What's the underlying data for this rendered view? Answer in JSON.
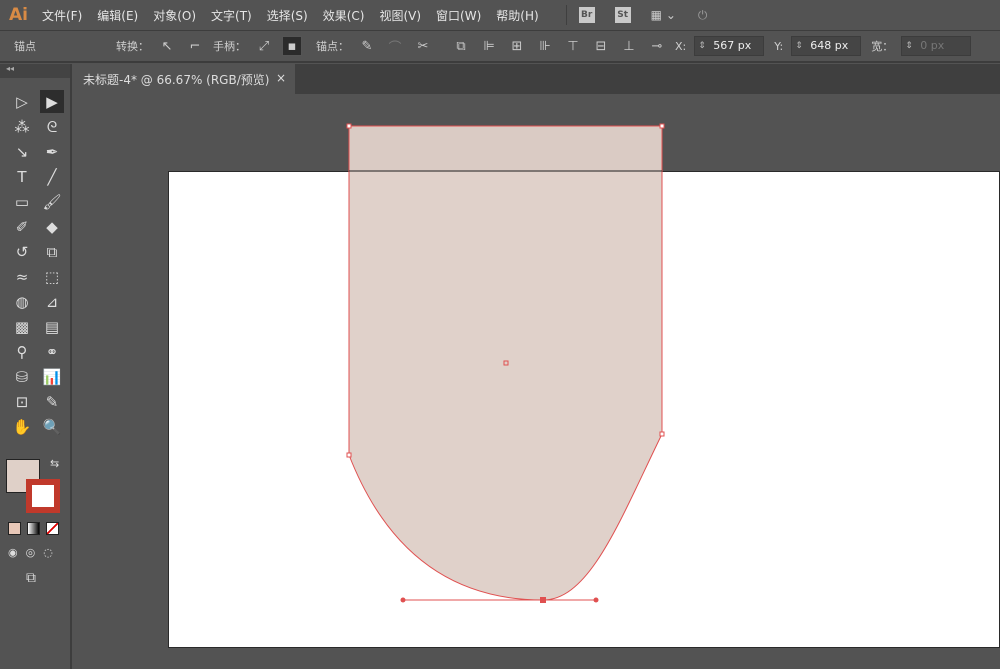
{
  "menubar": {
    "logo": "Ai",
    "items": [
      "文件(F)",
      "编辑(E)",
      "对象(O)",
      "文字(T)",
      "选择(S)",
      "效果(C)",
      "视图(V)",
      "窗口(W)",
      "帮助(H)"
    ],
    "badges": [
      "Br",
      "St"
    ]
  },
  "control": {
    "mode": "锚点",
    "convert_label": "转换：",
    "handles_label": "手柄：",
    "anchor_label": "锚点：",
    "x_label": "X:",
    "x_value": "567 px",
    "y_label": "Y:",
    "y_value": "648 px",
    "w_label": "宽：",
    "w_value": "0 px"
  },
  "document": {
    "tab_title": "未标题-4* @ 66.67% (RGB/预览)",
    "close": "×"
  },
  "colors": {
    "fill": "#dfd0c8",
    "stroke": "#e05050",
    "artboard": "#ffffff",
    "ui": "#535353"
  }
}
